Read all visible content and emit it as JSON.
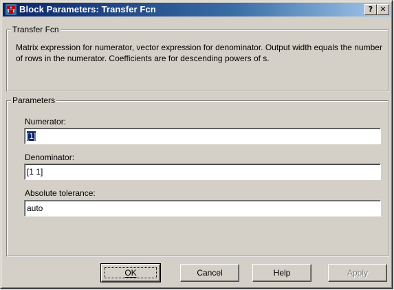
{
  "window": {
    "title": "Block Parameters: Transfer Fcn",
    "help_glyph": "?",
    "close_glyph": "✕"
  },
  "block_group": {
    "legend": "Transfer Fcn",
    "description": "Matrix expression for numerator, vector expression for denominator.  Output width equals the number of rows in the numerator.  Coefficients are for descending powers of s."
  },
  "parameters_group": {
    "legend": "Parameters",
    "fields": [
      {
        "label": "Numerator:",
        "value": "[1]"
      },
      {
        "label": "Denominator:",
        "value": "[1 1]"
      },
      {
        "label": "Absolute tolerance:",
        "value": "auto"
      }
    ]
  },
  "buttons": {
    "ok": "OK",
    "cancel": "Cancel",
    "help": "Help",
    "apply": "Apply"
  },
  "colors": {
    "titlebar_start": "#0a246a",
    "titlebar_end": "#a6caf0",
    "dialog_face": "#d4d0c8"
  }
}
